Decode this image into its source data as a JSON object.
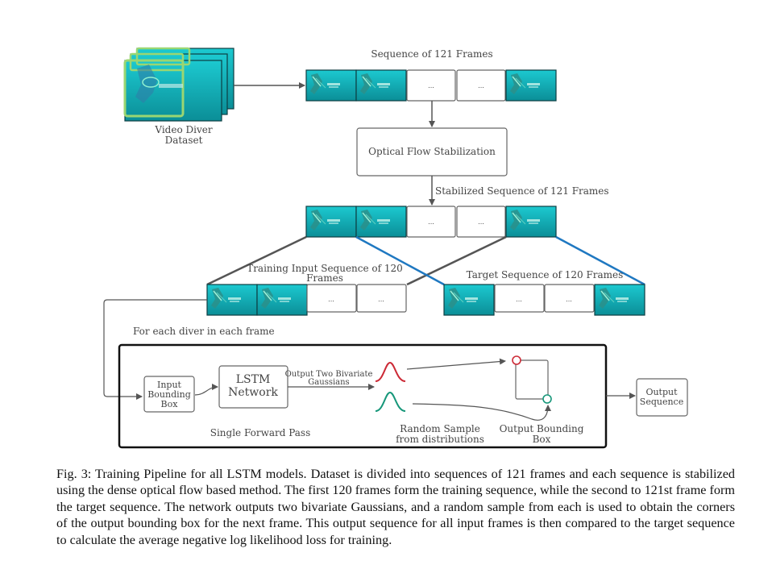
{
  "figure": {
    "dataset": {
      "label_line1": "Video Diver",
      "label_line2": "Dataset"
    },
    "sequence": {
      "title": "Sequence of 121 Frames",
      "ellipsis": "..."
    },
    "stabilization": {
      "box_label": "Optical Flow Stabilization",
      "edge_label": "Stabilized Sequence of 121 Frames"
    },
    "training_input": {
      "title_line1": "Training Input Sequence of 120",
      "title_line2": "Frames"
    },
    "target": {
      "title": "Target Sequence of 120 Frames"
    },
    "loop_label": "For each diver in each frame",
    "forward_pass": {
      "label": "Single Forward Pass",
      "input_box": [
        "Input",
        "Bounding",
        "Box"
      ],
      "lstm_box": [
        "LSTM",
        "Network"
      ],
      "output_edge": [
        "Output Two Bivariate",
        "Gaussians"
      ],
      "sample_label": [
        "Random Sample",
        "from distributions"
      ],
      "bbox_label": [
        "Output Bounding",
        "Box"
      ]
    },
    "output_sequence": [
      "Output",
      "Sequence"
    ],
    "colors": {
      "frame_teal": "#14b3bd",
      "frame_teal_dark": "#0a7f88",
      "gaussian_red": "#cc2a36",
      "gaussian_green": "#17977a",
      "target_link_blue": "#1f78c1",
      "input_link_gray": "#555555",
      "highlight_green": "#9ad672"
    }
  },
  "caption": {
    "text": "Fig. 3: Training Pipeline for all LSTM models. Dataset is divided into sequences of 121 frames and each sequence is stabilized using the dense optical flow based method. The first 120 frames form the training sequence, while the second to 121st frame form the target sequence. The network outputs two bivariate Gaussians, and a random sample from each is used to obtain the corners of the output bounding box for the next frame. This output sequence for all input frames is then compared to the target sequence to calculate the average negative log likelihood loss for training."
  }
}
